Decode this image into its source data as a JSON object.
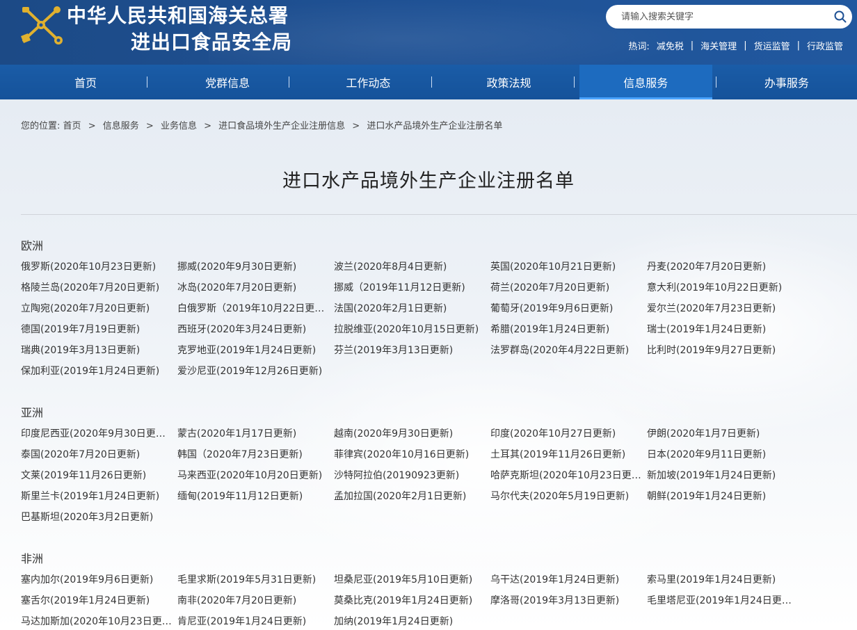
{
  "header": {
    "title_line1": "中华人民共和国海关总署",
    "title_line2": "进出口食品安全局",
    "search": {
      "placeholder": "请输入搜索关键字"
    },
    "hotwords_label": "热词:",
    "hotwords": [
      "减免税",
      "海关管理",
      "货运监管",
      "行政监管"
    ]
  },
  "nav": {
    "items": [
      "首页",
      "党群信息",
      "工作动态",
      "政策法规",
      "信息服务",
      "办事服务"
    ],
    "active_index": 4
  },
  "breadcrumb": {
    "prefix": "您的位置:",
    "items": [
      "首页",
      "信息服务",
      "业务信息",
      "进口食品境外生产企业注册信息",
      "进口水产品境外生产企业注册名单"
    ],
    "separator": ">"
  },
  "page_title": "进口水产品境外生产企业注册名单",
  "regions": [
    {
      "name": "欧洲",
      "countries": [
        "俄罗斯(2020年10月23日更新)",
        "挪威(2020年9月30日更新)",
        "波兰(2020年8月4日更新)",
        "英国(2020年10月21日更新)",
        "丹麦(2020年7月20日更新)",
        "格陵兰岛(2020年7月20日更新)",
        "冰岛(2020年7月20日更新)",
        "挪威（2019年11月12日更新)",
        "荷兰(2020年7月20日更新)",
        "意大利(2019年10月22日更新)",
        "立陶宛(2020年7月20日更新)",
        "白俄罗斯（2019年10月22日更新...",
        "法国(2020年2月1日更新)",
        "葡萄牙(2019年9月6日更新)",
        "爱尔兰(2020年7月23日更新)",
        "德国(2019年7月19日更新)",
        "西班牙(2020年3月24日更新)",
        "拉脱维亚(2020年10月15日更新)",
        "希腊(2019年1月24日更新)",
        "瑞士(2019年1月24日更新)",
        "瑞典(2019年3月13日更新)",
        "克罗地亚(2019年1月24日更新)",
        "芬兰(2019年3月13日更新)",
        "法罗群岛(2020年4月22日更新)",
        "比利时(2019年9月27日更新)",
        "保加利亚(2019年1月24日更新)",
        "爱沙尼亚(2019年12月26日更新)"
      ]
    },
    {
      "name": "亚洲",
      "countries": [
        "印度尼西亚(2020年9月30日更新...",
        "蒙古(2020年1月17日更新)",
        "越南(2020年9月30日更新)",
        "印度(2020年10月27日更新)",
        "伊朗(2020年1月7日更新)",
        "泰国(2020年7月20日更新)",
        "韩国（2020年7月23日更新)",
        "菲律宾(2020年10月16日更新)",
        "土耳其(2019年11月26日更新)",
        "日本(2020年9月11日更新)",
        "文莱(2019年11月26日更新)",
        "马来西亚(2020年10月20日更新)",
        "沙特阿拉伯(20190923更新)",
        "哈萨克斯坦(2020年10月23日更新...",
        "新加坡(2019年1月24日更新)",
        "斯里兰卡(2019年1月24日更新)",
        "缅甸(2019年11月12日更新)",
        "孟加拉国(2020年2月1日更新)",
        "马尔代夫(2020年5月19日更新)",
        "朝鲜(2019年1月24日更新)",
        "巴基斯坦(2020年3月2日更新)"
      ]
    },
    {
      "name": "非洲",
      "countries": [
        "塞内加尔(2019年9月6日更新)",
        "毛里求斯(2019年5月31日更新)",
        "坦桑尼亚(2019年5月10日更新)",
        "乌干达(2019年1月24日更新)",
        "索马里(2019年1月24日更新)",
        "塞舌尔(2019年1月24日更新)",
        "南非(2020年7月20日更新)",
        "莫桑比克(2019年1月24日更新)",
        "摩洛哥(2019年3月13日更新)",
        "毛里塔尼亚(2019年1月24日更新...",
        "马达加斯加(2020年10月23日更新...",
        "肯尼亚(2019年1月24日更新)",
        "加纳(2019年1月24日更新)"
      ]
    }
  ],
  "colors": {
    "header_bg": "#1f5194",
    "nav_bg": "#15529a",
    "nav_active": "#1d6bbf",
    "emblem_gold": "#e0b12f"
  },
  "icons": {
    "emblem": "customs-emblem-icon",
    "search": "search-icon"
  }
}
